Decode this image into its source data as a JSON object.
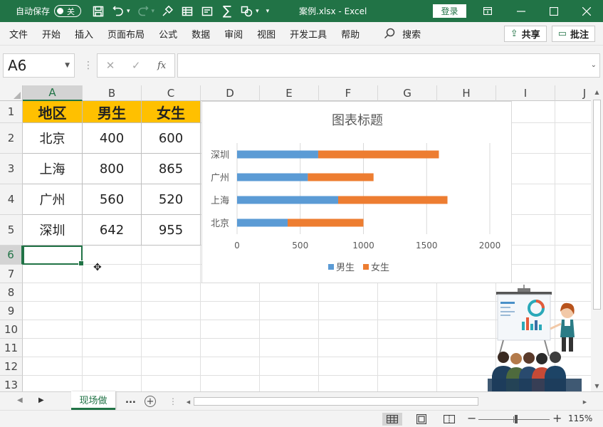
{
  "titlebar": {
    "autosave_label": "自动保存",
    "autosave_state": "关",
    "title": "案例.xlsx  -  Excel",
    "login_label": "登录"
  },
  "ribbon": {
    "tabs": [
      "文件",
      "开始",
      "插入",
      "页面布局",
      "公式",
      "数据",
      "审阅",
      "视图",
      "开发工具",
      "帮助"
    ],
    "search_label": "搜索",
    "share_label": "共享",
    "comments_label": "批注"
  },
  "formula_bar": {
    "name_box": "A6",
    "fx_label": "fx",
    "formula": ""
  },
  "sheet": {
    "columns": [
      "A",
      "B",
      "C",
      "D",
      "E",
      "F",
      "G",
      "H",
      "I",
      "J"
    ],
    "rows": [
      "1",
      "2",
      "3",
      "4",
      "5",
      "6",
      "7",
      "8",
      "9",
      "10",
      "11",
      "12",
      "13"
    ],
    "selected_column": "A",
    "selected_row": "6",
    "header": [
      "地区",
      "男生",
      "女生"
    ],
    "data": [
      [
        "北京",
        "400",
        "600"
      ],
      [
        "上海",
        "800",
        "865"
      ],
      [
        "广州",
        "560",
        "520"
      ],
      [
        "深圳",
        "642",
        "955"
      ]
    ],
    "header_fill": "#ffc000"
  },
  "chart_data": {
    "type": "bar",
    "orientation": "horizontal",
    "stacked": true,
    "title": "图表标题",
    "categories": [
      "北京",
      "上海",
      "广州",
      "深圳"
    ],
    "series": [
      {
        "name": "男生",
        "values": [
          400,
          800,
          560,
          642
        ],
        "color": "#5b9bd5"
      },
      {
        "name": "女生",
        "values": [
          600,
          865,
          520,
          955
        ],
        "color": "#ed7d31"
      }
    ],
    "xlim": [
      0,
      2000
    ],
    "xticks": [
      "0",
      "500",
      "1000",
      "1500",
      "2000"
    ],
    "grid": true,
    "legend": "bottom"
  },
  "sheet_tabs": {
    "active": "现场做",
    "more": "..."
  },
  "statusbar": {
    "zoom": "115%"
  },
  "colors": {
    "excel_green": "#217346"
  }
}
